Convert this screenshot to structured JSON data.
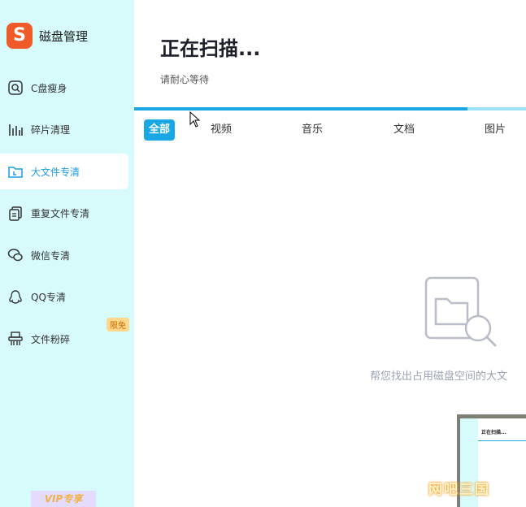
{
  "app": {
    "logo_glyph": "S",
    "name": "磁盘管理",
    "vip_label": "VIP专享"
  },
  "sidebar": {
    "items": [
      {
        "label": "C盘瘦身",
        "icon": "disk-search-icon"
      },
      {
        "label": "碎片清理",
        "icon": "fragment-bars-icon"
      },
      {
        "label": "大文件专清",
        "icon": "large-file-folder-icon",
        "active": true
      },
      {
        "label": "重复文件专清",
        "icon": "duplicate-files-icon"
      },
      {
        "label": "微信专清",
        "icon": "wechat-icon"
      },
      {
        "label": "QQ专清",
        "icon": "qq-penguin-icon"
      },
      {
        "label": "文件粉碎",
        "icon": "shredder-icon",
        "badge": "限免"
      }
    ]
  },
  "main": {
    "title": "正在扫描...",
    "subtitle": "请耐心等待",
    "progress": 0.85,
    "tabs": [
      {
        "label": "全部",
        "active": true
      },
      {
        "label": "视频"
      },
      {
        "label": "音乐"
      },
      {
        "label": "文档"
      },
      {
        "label": "图片"
      }
    ],
    "empty_text": "帮您找出占用磁盘空间的大文",
    "empty_icon": "folder-search-icon"
  },
  "thumbnail": {
    "title": "正在扫描..."
  },
  "watermark": "网吧三国",
  "colors": {
    "sidebar_bg": "#d7fbfb",
    "accent": "#1aa7e6",
    "logo": "#f05a28",
    "badge_bg": "#ffd78a"
  }
}
